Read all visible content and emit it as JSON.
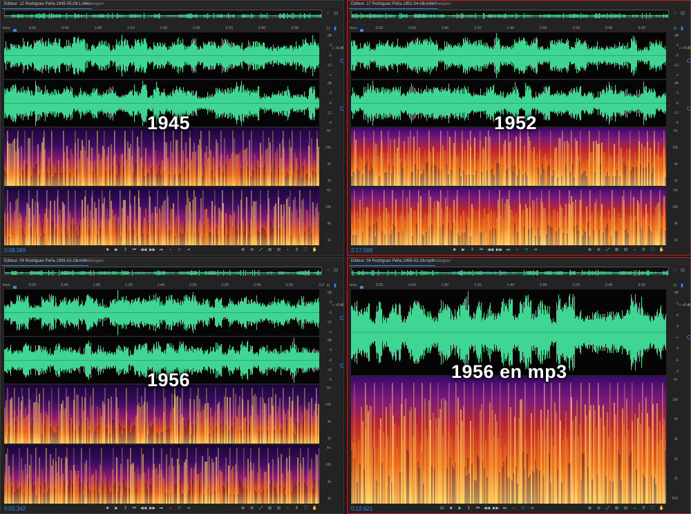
{
  "panels": [
    {
      "id": "p1",
      "tab_editor": "Editeur: 12 Rodriguez Peña 1945-05-03 1.m4a",
      "tab_mixer": "Mélangeur",
      "ruler_unit": "hms",
      "ruler_ticks": [
        "0:20",
        "0:40",
        "1:00",
        "1:20",
        "1:40",
        "2:00",
        "2:20",
        "2:40",
        "3:00"
      ],
      "year_label": "1945",
      "time": "0:08.389",
      "active": false,
      "channels": 2,
      "loud_spectrum": false
    },
    {
      "id": "p2",
      "tab_editor": "Editeur: 17 Rodriguez Peña 1952-04-08.m4a *",
      "tab_mixer": "Mélangeur",
      "ruler_unit": "hms",
      "ruler_ticks": [
        "0:20",
        "0:40",
        "1:00",
        "1:20",
        "1:40",
        "2:00",
        "2:20",
        "2:40",
        "3:00"
      ],
      "year_label": "1952",
      "time": "2:17.568",
      "active": true,
      "channels": 2,
      "loud_spectrum": true
    },
    {
      "id": "p3",
      "tab_editor": "Editeur: 04 Rodriguez Peña 1956-02-23.m4a",
      "tab_mixer": "Mélangeur",
      "ruler_unit": "hms",
      "ruler_ticks": [
        "0:20",
        "0:40",
        "1:00",
        "1:20",
        "1:40",
        "2:00",
        "2:20",
        "2:40",
        "3:00",
        "3:2"
      ],
      "year_label": "1956",
      "time": "0:02.342",
      "active": false,
      "channels": 2,
      "loud_spectrum": false
    },
    {
      "id": "p4",
      "tab_editor": "Editeur: 04 Rodriguez Peña 1956-02-23.mp3",
      "tab_mixer": "Mélangeur",
      "ruler_unit": "hms",
      "ruler_ticks": [
        "0:20",
        "0:40",
        "1:00",
        "1:20",
        "1:40",
        "2:00",
        "2:20",
        "2:40",
        "3:00"
      ],
      "year_label": "1956 en mp3",
      "time": "0:12.621",
      "active": true,
      "channels": 1,
      "loud_spectrum": true
    }
  ],
  "db_scale": [
    "dB",
    "-3",
    "-6",
    "-12",
    "∞",
    "-12",
    "-6",
    "-3"
  ],
  "db_scale_mono": [
    "dB",
    "-3",
    "-6",
    "-9",
    "∞",
    "-9",
    "-6",
    "-3"
  ],
  "hz_scale": [
    "Hz",
    "10k",
    "4k",
    "1k"
  ],
  "hz_scale_mono": [
    "Hz",
    "10k",
    "6k",
    "4k",
    "2k",
    "1k",
    "500"
  ],
  "volume_label": "+0 dB",
  "play_speed": "1x",
  "colors": {
    "wave": "#3fd592",
    "accent": "#2d8cff",
    "active_border": "#c81e1e",
    "record": "#e02020"
  },
  "icons": {
    "stop": "stop-icon",
    "play": "play-icon",
    "pause": "pause-icon",
    "rewind": "rewind-icon",
    "forward": "fast-forward-icon",
    "record": "record-icon",
    "loop": "loop-icon",
    "skip": "skip-icon"
  }
}
